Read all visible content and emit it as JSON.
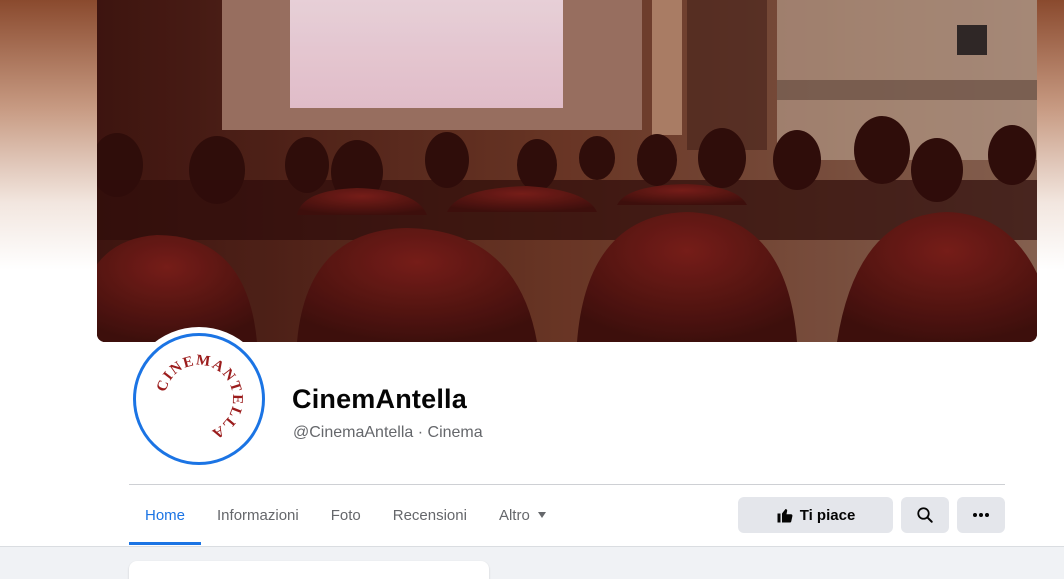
{
  "page": {
    "name": "CinemAntella",
    "handle": "@CinemaAntella · Cinema",
    "logo_text": "CINEMANTELLA"
  },
  "tabs": [
    {
      "label": "Home",
      "active": true
    },
    {
      "label": "Informazioni",
      "active": false
    },
    {
      "label": "Foto",
      "active": false
    },
    {
      "label": "Recensioni",
      "active": false
    },
    {
      "label": "Altro",
      "active": false
    }
  ],
  "actions": {
    "like_label": "Ti piace",
    "like_icon": "thumbs-up-icon",
    "search_icon": "search-icon",
    "more_icon": "more-dots-icon"
  },
  "colors": {
    "accent": "#1b74e4",
    "logo_red": "#9b1c1c",
    "button_bg": "#e4e6eb",
    "muted_text": "#65676b"
  }
}
